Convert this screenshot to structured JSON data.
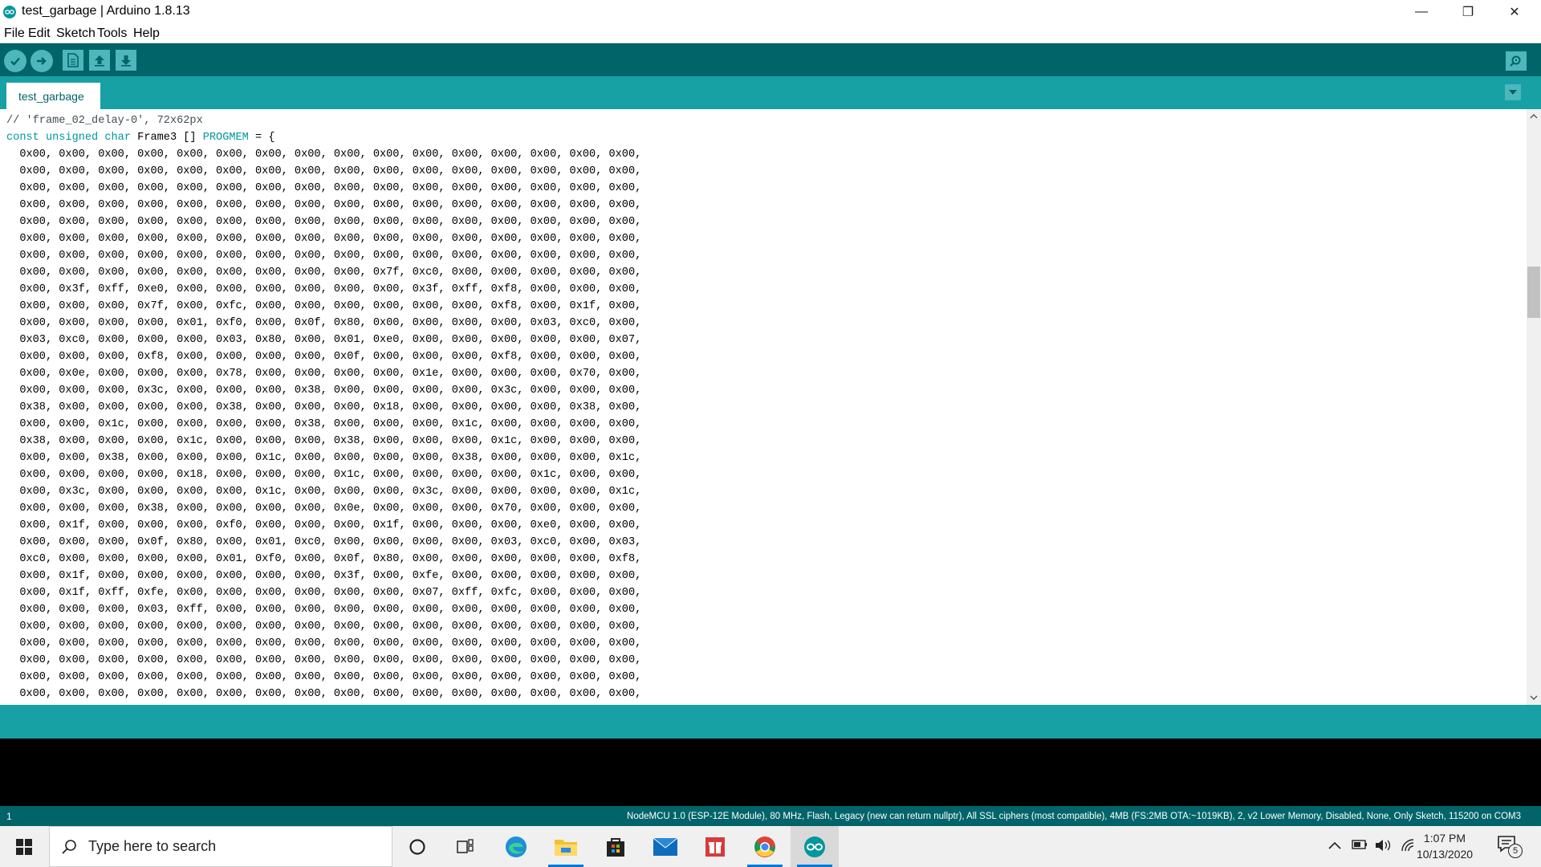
{
  "window": {
    "title": "test_garbage | Arduino 1.8.13",
    "minimize_symbol": "—",
    "restore_symbol": "❐",
    "close_symbol": "✕"
  },
  "menu": [
    "File",
    "Edit",
    "Sketch",
    "Tools",
    "Help"
  ],
  "toolbar": {
    "buttons": [
      "verify-icon",
      "upload-icon",
      "new-icon",
      "open-icon",
      "save-icon"
    ],
    "serial_monitor_icon": "magnifier-icon"
  },
  "tabs": [
    {
      "label": "test_garbage",
      "active": true
    }
  ],
  "editor": {
    "lines": [
      {
        "type": "comment",
        "text": "// 'frame_02_delay-0', 72x62px"
      },
      {
        "type": "decl",
        "kw": "const unsigned char",
        "name": " Frame3 [] ",
        "kw2": "PROGMEM",
        "rest": " = {"
      },
      {
        "type": "data",
        "text": "  0x00, 0x00, 0x00, 0x00, 0x00, 0x00, 0x00, 0x00, 0x00, 0x00, 0x00, 0x00, 0x00, 0x00, 0x00, 0x00,"
      },
      {
        "type": "data",
        "text": "  0x00, 0x00, 0x00, 0x00, 0x00, 0x00, 0x00, 0x00, 0x00, 0x00, 0x00, 0x00, 0x00, 0x00, 0x00, 0x00,"
      },
      {
        "type": "data",
        "text": "  0x00, 0x00, 0x00, 0x00, 0x00, 0x00, 0x00, 0x00, 0x00, 0x00, 0x00, 0x00, 0x00, 0x00, 0x00, 0x00,"
      },
      {
        "type": "data",
        "text": "  0x00, 0x00, 0x00, 0x00, 0x00, 0x00, 0x00, 0x00, 0x00, 0x00, 0x00, 0x00, 0x00, 0x00, 0x00, 0x00,"
      },
      {
        "type": "data",
        "text": "  0x00, 0x00, 0x00, 0x00, 0x00, 0x00, 0x00, 0x00, 0x00, 0x00, 0x00, 0x00, 0x00, 0x00, 0x00, 0x00,"
      },
      {
        "type": "data",
        "text": "  0x00, 0x00, 0x00, 0x00, 0x00, 0x00, 0x00, 0x00, 0x00, 0x00, 0x00, 0x00, 0x00, 0x00, 0x00, 0x00,"
      },
      {
        "type": "data",
        "text": "  0x00, 0x00, 0x00, 0x00, 0x00, 0x00, 0x00, 0x00, 0x00, 0x00, 0x00, 0x00, 0x00, 0x00, 0x00, 0x00,"
      },
      {
        "type": "data",
        "text": "  0x00, 0x00, 0x00, 0x00, 0x00, 0x00, 0x00, 0x00, 0x00, 0x7f, 0xc0, 0x00, 0x00, 0x00, 0x00, 0x00,"
      },
      {
        "type": "data",
        "text": "  0x00, 0x3f, 0xff, 0xe0, 0x00, 0x00, 0x00, 0x00, 0x00, 0x00, 0x3f, 0xff, 0xf8, 0x00, 0x00, 0x00,"
      },
      {
        "type": "data",
        "text": "  0x00, 0x00, 0x00, 0x7f, 0x00, 0xfc, 0x00, 0x00, 0x00, 0x00, 0x00, 0x00, 0xf8, 0x00, 0x1f, 0x00,"
      },
      {
        "type": "data",
        "text": "  0x00, 0x00, 0x00, 0x00, 0x01, 0xf0, 0x00, 0x0f, 0x80, 0x00, 0x00, 0x00, 0x00, 0x03, 0xc0, 0x00,"
      },
      {
        "type": "data",
        "text": "  0x03, 0xc0, 0x00, 0x00, 0x00, 0x03, 0x80, 0x00, 0x01, 0xe0, 0x00, 0x00, 0x00, 0x00, 0x00, 0x07,"
      },
      {
        "type": "data",
        "text": "  0x00, 0x00, 0x00, 0xf8, 0x00, 0x00, 0x00, 0x00, 0x0f, 0x00, 0x00, 0x00, 0xf8, 0x00, 0x00, 0x00,"
      },
      {
        "type": "data",
        "text": "  0x00, 0x0e, 0x00, 0x00, 0x00, 0x78, 0x00, 0x00, 0x00, 0x00, 0x1e, 0x00, 0x00, 0x00, 0x70, 0x00,"
      },
      {
        "type": "data",
        "text": "  0x00, 0x00, 0x00, 0x3c, 0x00, 0x00, 0x00, 0x38, 0x00, 0x00, 0x00, 0x00, 0x3c, 0x00, 0x00, 0x00,"
      },
      {
        "type": "data",
        "text": "  0x38, 0x00, 0x00, 0x00, 0x00, 0x38, 0x00, 0x00, 0x00, 0x18, 0x00, 0x00, 0x00, 0x00, 0x38, 0x00,"
      },
      {
        "type": "data",
        "text": "  0x00, 0x00, 0x1c, 0x00, 0x00, 0x00, 0x00, 0x38, 0x00, 0x00, 0x00, 0x1c, 0x00, 0x00, 0x00, 0x00,"
      },
      {
        "type": "data",
        "text": "  0x38, 0x00, 0x00, 0x00, 0x1c, 0x00, 0x00, 0x00, 0x38, 0x00, 0x00, 0x00, 0x1c, 0x00, 0x00, 0x00,"
      },
      {
        "type": "data",
        "text": "  0x00, 0x00, 0x38, 0x00, 0x00, 0x00, 0x1c, 0x00, 0x00, 0x00, 0x00, 0x38, 0x00, 0x00, 0x00, 0x1c,"
      },
      {
        "type": "data",
        "text": "  0x00, 0x00, 0x00, 0x00, 0x18, 0x00, 0x00, 0x00, 0x1c, 0x00, 0x00, 0x00, 0x00, 0x1c, 0x00, 0x00,"
      },
      {
        "type": "data",
        "text": "  0x00, 0x3c, 0x00, 0x00, 0x00, 0x00, 0x1c, 0x00, 0x00, 0x00, 0x3c, 0x00, 0x00, 0x00, 0x00, 0x1c,"
      },
      {
        "type": "data",
        "text": "  0x00, 0x00, 0x00, 0x38, 0x00, 0x00, 0x00, 0x00, 0x0e, 0x00, 0x00, 0x00, 0x70, 0x00, 0x00, 0x00,"
      },
      {
        "type": "data",
        "text": "  0x00, 0x1f, 0x00, 0x00, 0x00, 0xf0, 0x00, 0x00, 0x00, 0x1f, 0x00, 0x00, 0x00, 0xe0, 0x00, 0x00,"
      },
      {
        "type": "data",
        "text": "  0x00, 0x00, 0x00, 0x0f, 0x80, 0x00, 0x01, 0xc0, 0x00, 0x00, 0x00, 0x00, 0x03, 0xc0, 0x00, 0x03,"
      },
      {
        "type": "data",
        "text": "  0xc0, 0x00, 0x00, 0x00, 0x00, 0x01, 0xf0, 0x00, 0x0f, 0x80, 0x00, 0x00, 0x00, 0x00, 0x00, 0xf8,"
      },
      {
        "type": "data",
        "text": "  0x00, 0x1f, 0x00, 0x00, 0x00, 0x00, 0x00, 0x00, 0x3f, 0x00, 0xfe, 0x00, 0x00, 0x00, 0x00, 0x00,"
      },
      {
        "type": "data",
        "text": "  0x00, 0x1f, 0xff, 0xfe, 0x00, 0x00, 0x00, 0x00, 0x00, 0x00, 0x07, 0xff, 0xfc, 0x00, 0x00, 0x00,"
      },
      {
        "type": "data",
        "text": "  0x00, 0x00, 0x00, 0x03, 0xff, 0x00, 0x00, 0x00, 0x00, 0x00, 0x00, 0x00, 0x00, 0x00, 0x00, 0x00,"
      },
      {
        "type": "data",
        "text": "  0x00, 0x00, 0x00, 0x00, 0x00, 0x00, 0x00, 0x00, 0x00, 0x00, 0x00, 0x00, 0x00, 0x00, 0x00, 0x00,"
      },
      {
        "type": "data",
        "text": "  0x00, 0x00, 0x00, 0x00, 0x00, 0x00, 0x00, 0x00, 0x00, 0x00, 0x00, 0x00, 0x00, 0x00, 0x00, 0x00,"
      },
      {
        "type": "data",
        "text": "  0x00, 0x00, 0x00, 0x00, 0x00, 0x00, 0x00, 0x00, 0x00, 0x00, 0x00, 0x00, 0x00, 0x00, 0x00, 0x00,"
      },
      {
        "type": "data",
        "text": "  0x00, 0x00, 0x00, 0x00, 0x00, 0x00, 0x00, 0x00, 0x00, 0x00, 0x00, 0x00, 0x00, 0x00, 0x00, 0x00,"
      },
      {
        "type": "data",
        "text": "  0x00, 0x00, 0x00, 0x00, 0x00, 0x00, 0x00, 0x00, 0x00, 0x00, 0x00, 0x00, 0x00, 0x00, 0x00, 0x00,"
      }
    ]
  },
  "status": {
    "line": "1",
    "board": "NodeMCU 1.0 (ESP-12E Module), 80 MHz, Flash, Legacy (new can return nullptr), All SSL ciphers (most compatible), 4MB (FS:2MB OTA:~1019KB), 2, v2 Lower Memory, Disabled, None, Only Sketch, 115200 on COM3"
  },
  "taskbar": {
    "search_placeholder": "Type here to search",
    "apps": [
      "cortana-icon",
      "task-view-icon",
      "edge-icon",
      "file-explorer-icon",
      "store-icon",
      "mail-icon",
      "gift-app-icon",
      "chrome-icon",
      "arduino-icon"
    ],
    "time": "1:07 PM",
    "date": "10/13/2020",
    "notification_count": "5"
  },
  "colors": {
    "toolbar": "#006468",
    "tabbar": "#17a1a5",
    "button": "#4db7bb",
    "keyword": "#00979d"
  }
}
